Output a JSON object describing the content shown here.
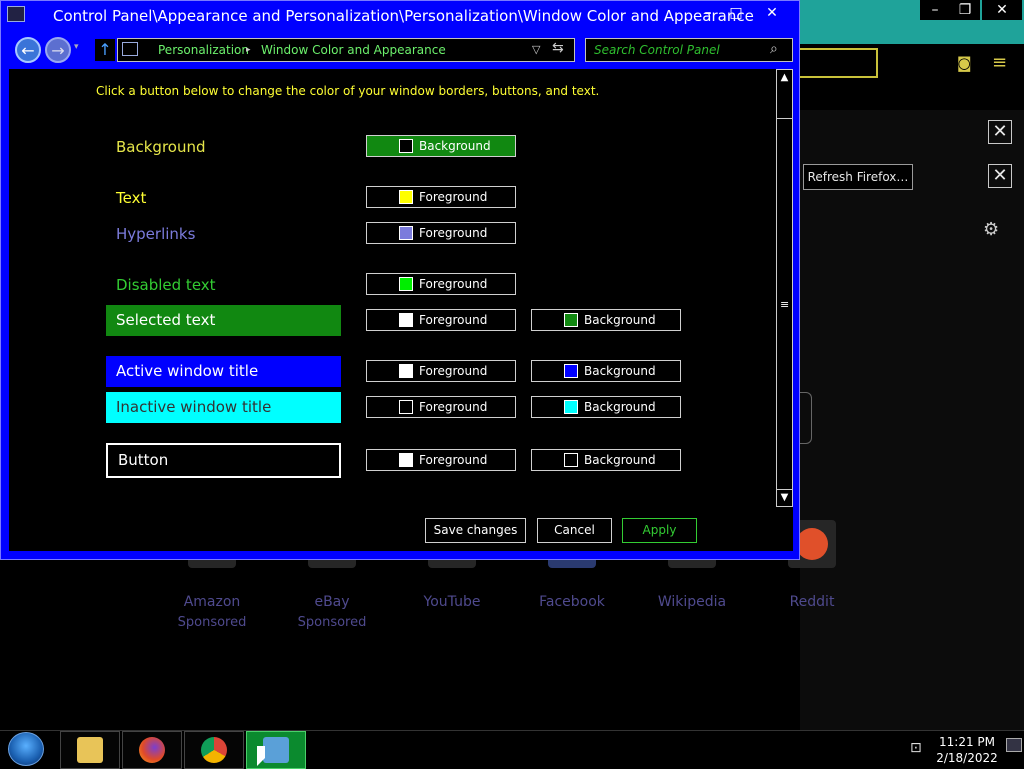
{
  "window": {
    "title": "Control Panel\\Appearance and Personalization\\Personalization\\Window Color and Appearance",
    "caption_minimize": "–",
    "caption_maximize": "□",
    "caption_close": "✕"
  },
  "nav": {
    "back_glyph": "←",
    "forward_glyph": "→",
    "history_glyph": "▾",
    "up_glyph": "↑",
    "breadcrumb": [
      "Personalization",
      "Window Color and Appearance"
    ],
    "breadcrumb_sep": "▸",
    "dropdown_glyph": "▽",
    "refresh_glyph": "⇆",
    "search_placeholder": "Search Control Panel",
    "search_glyph": "⌕"
  },
  "content": {
    "intro": "Click a button below to change the color of your window borders, buttons, and text.",
    "rows": [
      {
        "label": "Background",
        "label_color": "#e6e64a",
        "fg": {
          "text": "Background",
          "swatch": "#000000",
          "style": "bg"
        }
      },
      {
        "label": "Text",
        "label_color": "#ffff33",
        "fg": {
          "text": "Foreground",
          "swatch": "#ffff00"
        }
      },
      {
        "label": "Hyperlinks",
        "label_color": "#7b7bdc",
        "fg": {
          "text": "Foreground",
          "swatch": "#7b7bdc"
        }
      },
      {
        "label": "Disabled text",
        "label_color": "#33cc33",
        "fg": {
          "text": "Foreground",
          "swatch": "#00ee00"
        }
      },
      {
        "label": "Selected text",
        "fg": {
          "text": "Foreground",
          "swatch": "#ffffff"
        },
        "bg": {
          "text": "Background",
          "swatch": "#118811"
        }
      },
      {
        "label": "Active window title",
        "fg": {
          "text": "Foreground",
          "swatch": "#ffffff"
        },
        "bg": {
          "text": "Background",
          "swatch": "#0000ff"
        }
      },
      {
        "label": "Inactive window title",
        "fg": {
          "text": "Foreground",
          "swatch": "#000000"
        },
        "bg": {
          "text": "Background",
          "swatch": "#00ffff"
        }
      },
      {
        "label": "Button",
        "fg": {
          "text": "Foreground",
          "swatch": "#ffffff"
        },
        "bg": {
          "text": "Background",
          "swatch": "#000000"
        }
      }
    ],
    "scroll_up": "▲",
    "scroll_down": "▼",
    "scroll_grip": "≡"
  },
  "buttons": {
    "save": "Save changes",
    "cancel": "Cancel",
    "apply": "Apply"
  },
  "firefox": {
    "caption_minimize": "–",
    "caption_restore": "❐",
    "caption_close": "✕",
    "pocket_glyph": "◙",
    "menu_glyph": "≡",
    "close_glyph": "✕",
    "refresh_button": "Refresh Firefox…",
    "settings_glyph": "⚙",
    "sites": [
      {
        "name": "Amazon",
        "sub": "Sponsored"
      },
      {
        "name": "eBay",
        "sub": "Sponsored"
      },
      {
        "name": "YouTube",
        "sub": ""
      },
      {
        "name": "Facebook",
        "sub": ""
      },
      {
        "name": "Wikipedia",
        "sub": ""
      },
      {
        "name": "Reddit",
        "sub": ""
      }
    ]
  },
  "taskbar": {
    "time": "11:21 PM",
    "date": "2/18/2022"
  }
}
